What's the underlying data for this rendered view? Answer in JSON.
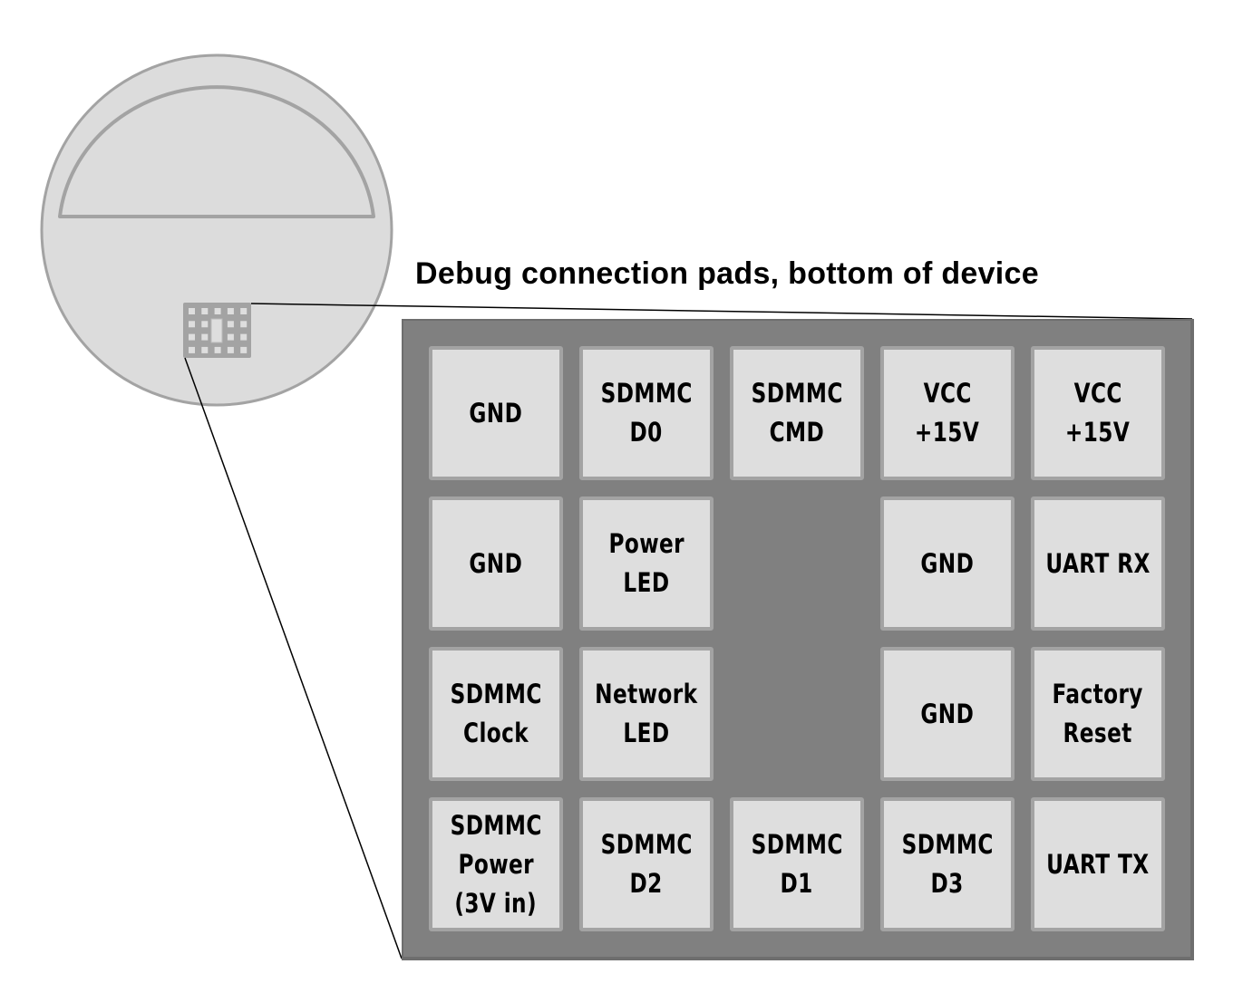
{
  "title": "Debug connection pads, bottom of device",
  "device": {
    "shape": "round device, bottom view",
    "colors": {
      "body_fill": "#dcdcdc",
      "body_outline": "#a3a3a3",
      "board_fill": "#808080",
      "pad_fill": "#dedede",
      "pad_border": "#a3a3a3",
      "text": "#000000",
      "callout_line": "#000000"
    }
  },
  "pad_grid": {
    "rows": 4,
    "cols": 5,
    "pads": [
      {
        "row": 0,
        "col": 0,
        "lines": [
          "GND"
        ]
      },
      {
        "row": 0,
        "col": 1,
        "lines": [
          "SDMMC",
          "D0"
        ]
      },
      {
        "row": 0,
        "col": 2,
        "lines": [
          "SDMMC",
          "CMD"
        ]
      },
      {
        "row": 0,
        "col": 3,
        "lines": [
          "VCC",
          "+15V"
        ]
      },
      {
        "row": 0,
        "col": 4,
        "lines": [
          "VCC",
          "+15V"
        ]
      },
      {
        "row": 1,
        "col": 0,
        "lines": [
          "GND"
        ]
      },
      {
        "row": 1,
        "col": 1,
        "lines": [
          "Power",
          "LED"
        ]
      },
      {
        "row": 1,
        "col": 3,
        "lines": [
          "GND"
        ]
      },
      {
        "row": 1,
        "col": 4,
        "lines": [
          "UART RX"
        ]
      },
      {
        "row": 2,
        "col": 0,
        "lines": [
          "SDMMC",
          "Clock"
        ]
      },
      {
        "row": 2,
        "col": 1,
        "lines": [
          "Network",
          "LED"
        ]
      },
      {
        "row": 2,
        "col": 3,
        "lines": [
          "GND"
        ]
      },
      {
        "row": 2,
        "col": 4,
        "lines": [
          "Factory",
          "Reset"
        ]
      },
      {
        "row": 3,
        "col": 0,
        "lines": [
          "SDMMC",
          "Power",
          "(3V in)"
        ]
      },
      {
        "row": 3,
        "col": 1,
        "lines": [
          "SDMMC",
          "D2"
        ]
      },
      {
        "row": 3,
        "col": 2,
        "lines": [
          "SDMMC",
          "D1"
        ]
      },
      {
        "row": 3,
        "col": 3,
        "lines": [
          "SDMMC",
          "D3"
        ]
      },
      {
        "row": 3,
        "col": 4,
        "lines": [
          "UART TX"
        ]
      }
    ],
    "empty_cells": [
      {
        "row": 1,
        "col": 2
      },
      {
        "row": 2,
        "col": 2
      }
    ]
  }
}
